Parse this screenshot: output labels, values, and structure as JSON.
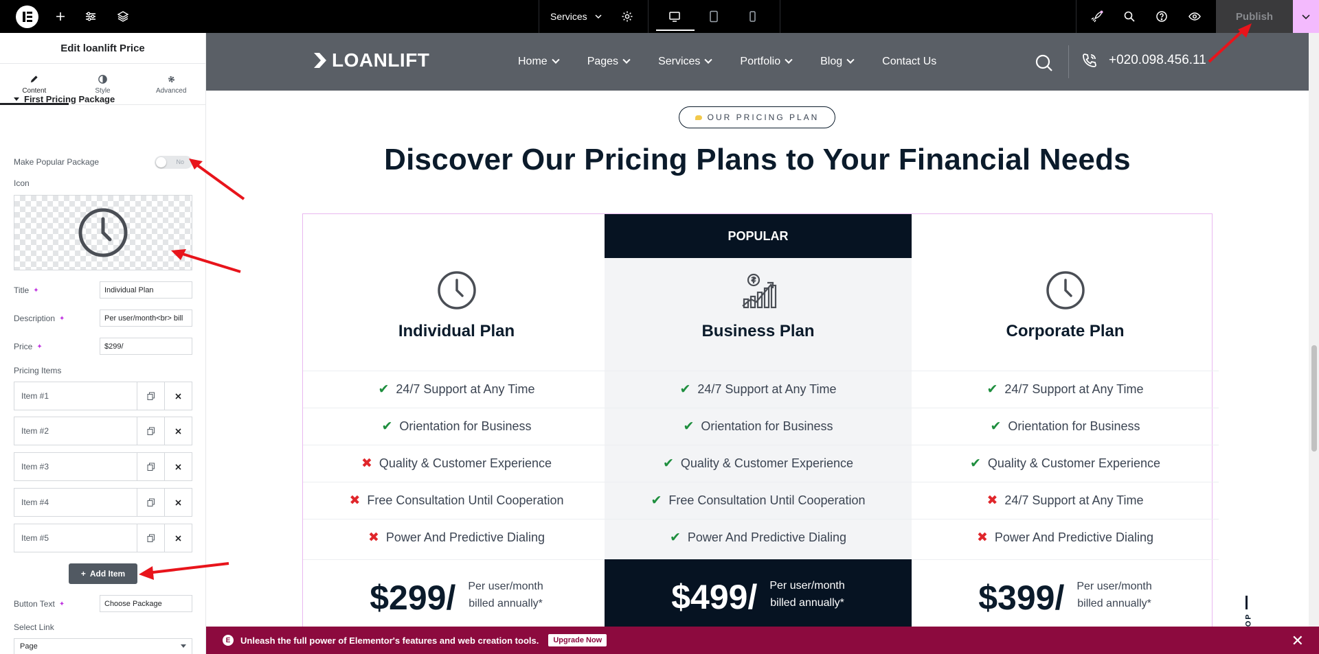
{
  "topbar": {
    "page_name": "Services",
    "publish_label": "Publish"
  },
  "panel": {
    "title": "Edit loanlift Price",
    "tabs": [
      {
        "label": "Content",
        "icon": "pencil-icon"
      },
      {
        "label": "Style",
        "icon": "half-circle-icon"
      },
      {
        "label": "Advanced",
        "icon": "gear-icon"
      }
    ],
    "section_title": "First Pricing Package",
    "popular_label": "Make Popular Package",
    "popular_value": "No",
    "icon_label": "Icon",
    "title_label": "Title",
    "title_value": "Individual Plan",
    "description_label": "Description",
    "description_value": "Per user/month<br> bill",
    "price_label": "Price",
    "price_value": "$299/",
    "pricing_items_label": "Pricing Items",
    "items": [
      "Item #1",
      "Item #2",
      "Item #3",
      "Item #4",
      "Item #5"
    ],
    "add_item_label": "Add Item",
    "button_text_label": "Button Text",
    "button_text_value": "Choose Package",
    "select_link_label": "Select Link",
    "select_link_value": "Page"
  },
  "site": {
    "brand": "LOANLIFT",
    "nav": [
      {
        "label": "Home",
        "dropdown": true
      },
      {
        "label": "Pages",
        "dropdown": true
      },
      {
        "label": "Services",
        "dropdown": true
      },
      {
        "label": "Portfolio",
        "dropdown": true
      },
      {
        "label": "Blog",
        "dropdown": true
      },
      {
        "label": "Contact Us",
        "dropdown": false
      }
    ],
    "phone": "+020.098.456.11",
    "pill": "OUR PRICING PLAN",
    "headline": "Discover Our Pricing Plans to Your Financial Needs",
    "popular_badge": "POPULAR",
    "plans": [
      {
        "name": "Individual Plan",
        "icon": "clock-icon",
        "features": [
          {
            "text": "24/7 Support at Any Time",
            "included": true
          },
          {
            "text": "Orientation for Business",
            "included": true
          },
          {
            "text": "Quality & Customer Experience",
            "included": false
          },
          {
            "text": "Free Consultation Until Cooperation",
            "included": false
          },
          {
            "text": "Power And Predictive Dialing",
            "included": false
          }
        ],
        "price": "$299/",
        "per_line1": "Per user/month",
        "per_line2": "billed annually*"
      },
      {
        "name": "Business Plan",
        "icon": "growth-chart-icon",
        "features": [
          {
            "text": "24/7 Support at Any Time",
            "included": true
          },
          {
            "text": "Orientation for Business",
            "included": true
          },
          {
            "text": "Quality & Customer Experience",
            "included": true
          },
          {
            "text": "Free Consultation Until Cooperation",
            "included": true
          },
          {
            "text": "Power And Predictive Dialing",
            "included": true
          }
        ],
        "price": "$499/",
        "per_line1": "Per user/month",
        "per_line2": "billed annually*"
      },
      {
        "name": "Corporate Plan",
        "icon": "clock-icon",
        "features": [
          {
            "text": "24/7 Support at Any Time",
            "included": true
          },
          {
            "text": "Orientation for Business",
            "included": true
          },
          {
            "text": "Quality & Customer Experience",
            "included": true
          },
          {
            "text": "24/7 Support at Any Time",
            "included": false
          },
          {
            "text": "Power And Predictive Dialing",
            "included": false
          }
        ],
        "price": "$399/",
        "per_line1": "Per user/month",
        "per_line2": "billed annually*"
      }
    ],
    "back_top": "BACK TOP"
  },
  "banner": {
    "text": "Unleash the full power of Elementor's features and web creation tools.",
    "upgrade_label": "Upgrade Now"
  },
  "colors": {
    "accent_pink": "#f3bafd",
    "navy": "#061322",
    "banner": "#8c0a3e",
    "check_green": "#1e8e3e",
    "cross_red": "#e0262b"
  }
}
